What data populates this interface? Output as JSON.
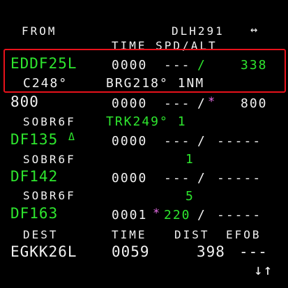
{
  "header": {
    "from_label": "FROM",
    "flight_number": "DLH291",
    "swap_icon": "↔",
    "column_header": "TIME SPD/ALT"
  },
  "rows": [
    {
      "ident": "EDDF25L",
      "time": "0000",
      "speed": "---",
      "slash": "/",
      "alt": "338",
      "sub": "C248°",
      "sub_info": "BRG218° 1NM"
    },
    {
      "ident": "800",
      "time": "0000",
      "speed": "---",
      "slash": "/",
      "constraint_star": "*",
      "alt": "800",
      "sub": "SOBR6F",
      "sub_info": "TRK249° 1"
    },
    {
      "ident": "DF135",
      "ident_symbol": "Δ",
      "time": "0000",
      "speed": "---",
      "slash": "/",
      "alt": "-----",
      "sub": "SOBR6F",
      "sub_info": "1"
    },
    {
      "ident": "DF142",
      "time": "0000",
      "speed": "---",
      "slash": "/",
      "alt": "-----",
      "sub": "SOBR6F",
      "sub_info": "5"
    },
    {
      "ident": "DF163",
      "time": "0001",
      "constraint_star": "*",
      "speed": "220",
      "slash": "/",
      "alt": "-----"
    }
  ],
  "footer": {
    "dest_label": "DEST",
    "time_label": "TIME",
    "dist_label": "DIST",
    "efob_label": "EFOB",
    "dest": "EGKK26L",
    "time": "0059",
    "dist": "398",
    "efob": "---",
    "scroll_icon": "↓↑"
  },
  "colors": {
    "active": "#2ee62e",
    "normal": "#f2f2f2",
    "constraint": "#e46ce4",
    "highlight": "#e8121b",
    "background": "#000000"
  }
}
